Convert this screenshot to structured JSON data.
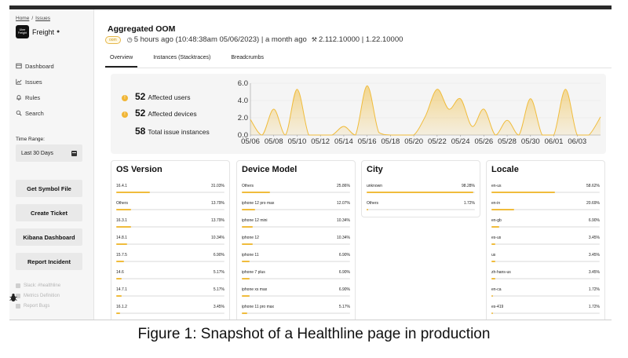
{
  "breadcrumbs": [
    "Home",
    "Issues"
  ],
  "breadcrumb_separator": "/",
  "app": {
    "logo_text": "Uber Freight",
    "name": "Freight",
    "platform_icon": "apple-icon"
  },
  "nav": [
    {
      "label": "Dashboard",
      "icon": "dashboard-icon"
    },
    {
      "label": "Issues",
      "icon": "chart-icon"
    },
    {
      "label": "Rules",
      "icon": "bell-icon"
    },
    {
      "label": "Search",
      "icon": "search-icon"
    }
  ],
  "time_range": {
    "label": "Time Range:",
    "value": "Last 30 Days",
    "icon": "calendar-icon"
  },
  "actions": [
    "Get Symbol File",
    "Create Ticket",
    "Kibana Dashboard",
    "Report Incident"
  ],
  "links": [
    "Slack: #healthline",
    "Metrics Definition",
    "Report Bugs"
  ],
  "issue": {
    "title": "Aggregated OOM",
    "badge": "oom",
    "time": "5 hours ago (10:48:38am 05/06/2023) | a month ago",
    "versions": "2.112.10000 | 1.22.10000"
  },
  "tabs": [
    "Overview",
    "Instances (Stacktraces)",
    "Breadcrumbs"
  ],
  "active_tab": "Overview",
  "summary": [
    {
      "value": "52",
      "label": "Affected users",
      "icon": "info-icon"
    },
    {
      "value": "52",
      "label": "Affected devices",
      "icon": "info-icon"
    },
    {
      "value": "58",
      "label": "Total issue instances",
      "icon": ""
    }
  ],
  "chart_data": {
    "type": "area",
    "x": [
      "05/06",
      "05/07",
      "05/08",
      "05/09",
      "05/10",
      "05/11",
      "05/12",
      "05/13",
      "05/14",
      "05/15",
      "05/16",
      "05/17",
      "05/18",
      "05/19",
      "05/20",
      "05/21",
      "05/22",
      "05/23",
      "05/24",
      "05/25",
      "05/26",
      "05/27",
      "05/28",
      "05/29",
      "05/30",
      "05/31",
      "06/01",
      "06/02",
      "06/03",
      "06/04",
      "06/05"
    ],
    "values": [
      1.8,
      0,
      3.0,
      0,
      5.3,
      0,
      0,
      0,
      1.0,
      0,
      5.7,
      0.3,
      0,
      0,
      0,
      2.2,
      5.3,
      3.0,
      4.2,
      1.0,
      3.0,
      0,
      1.7,
      0,
      4.2,
      0,
      0,
      5.3,
      0,
      0,
      2.1
    ],
    "yticks": [
      "0.0",
      "2.0",
      "4.0",
      "6.0"
    ],
    "xticks": [
      "05/06",
      "05/08",
      "05/10",
      "05/12",
      "05/14",
      "05/16",
      "05/18",
      "05/20",
      "05/22",
      "05/24",
      "05/26",
      "05/28",
      "05/30",
      "06/01",
      "06/03"
    ],
    "ylim": [
      0,
      6
    ],
    "title": "",
    "xlabel": "",
    "ylabel": "",
    "color": "#f0bc3c"
  },
  "cards": [
    {
      "title": "OS Version",
      "rows": [
        {
          "name": "16.4.1",
          "pct": "31.03%",
          "value": 31.03
        },
        {
          "name": "Others",
          "pct": "13.79%",
          "value": 13.79
        },
        {
          "name": "16.3.1",
          "pct": "13.79%",
          "value": 13.79
        },
        {
          "name": "14.8.1",
          "pct": "10.34%",
          "value": 10.34
        },
        {
          "name": "15.7.5",
          "pct": "6.90%",
          "value": 6.9
        },
        {
          "name": "14.6",
          "pct": "5.17%",
          "value": 5.17
        },
        {
          "name": "14.7.1",
          "pct": "5.17%",
          "value": 5.17
        },
        {
          "name": "16.1.2",
          "pct": "3.45%",
          "value": 3.45
        }
      ]
    },
    {
      "title": "Device Model",
      "rows": [
        {
          "name": "Others",
          "pct": "25.86%",
          "value": 25.86
        },
        {
          "name": "iphone 12 pro max",
          "pct": "12.07%",
          "value": 12.07
        },
        {
          "name": "iphone 12 mini",
          "pct": "10.34%",
          "value": 10.34
        },
        {
          "name": "iphone 12",
          "pct": "10.34%",
          "value": 10.34
        },
        {
          "name": "iphone 11",
          "pct": "6.90%",
          "value": 6.9
        },
        {
          "name": "iphone 7 plus",
          "pct": "6.90%",
          "value": 6.9
        },
        {
          "name": "iphone xs max",
          "pct": "6.90%",
          "value": 6.9
        },
        {
          "name": "iphone 11 pro max",
          "pct": "5.17%",
          "value": 5.17
        }
      ]
    },
    {
      "title": "City",
      "rows": [
        {
          "name": "unknown",
          "pct": "98.28%",
          "value": 98.28
        },
        {
          "name": "Others",
          "pct": "1.72%",
          "value": 1.72
        }
      ]
    },
    {
      "title": "Locale",
      "rows": [
        {
          "name": "en-us",
          "pct": "58.62%",
          "value": 58.62
        },
        {
          "name": "en-in",
          "pct": "20.69%",
          "value": 20.69
        },
        {
          "name": "en-gb",
          "pct": "6.90%",
          "value": 6.9
        },
        {
          "name": "es-us",
          "pct": "3.45%",
          "value": 3.45
        },
        {
          "name": "us",
          "pct": "3.45%",
          "value": 3.45
        },
        {
          "name": "zh-hans-us",
          "pct": "3.45%",
          "value": 3.45
        },
        {
          "name": "en-ca",
          "pct": "1.72%",
          "value": 1.72
        },
        {
          "name": "es-419",
          "pct": "1.72%",
          "value": 1.72
        }
      ]
    }
  ],
  "caption": "Figure 1: Snapshot of a Healthline page in production"
}
